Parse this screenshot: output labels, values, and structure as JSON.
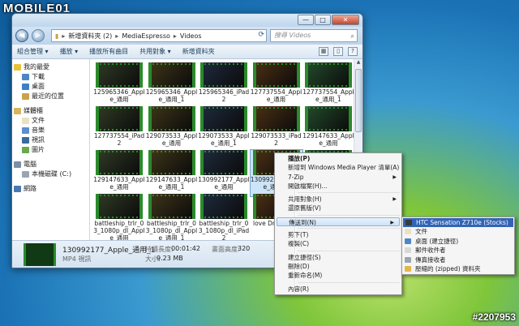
{
  "watermark": {
    "logo": "MOBILE01",
    "id": "#2207953"
  },
  "window": {
    "controls": {
      "min": "—",
      "max": "□",
      "close": "✕"
    },
    "address": {
      "segments": [
        "新增資料夾 (2)",
        "MediaEspresso",
        "Videos"
      ]
    },
    "search_placeholder": "搜尋 Videos",
    "toolbar": {
      "organize": "組合管理 ▾",
      "play": "播放 ▾",
      "play_all": "播放所有曲目",
      "share": "共用對象 ▾",
      "new_folder": "新增資料夾"
    }
  },
  "nav": {
    "favorites": "我的最愛",
    "favorites_items": [
      "下載",
      "桌面",
      "最近的位置"
    ],
    "libraries": "媒體櫃",
    "libraries_items": [
      "文件",
      "音樂",
      "視訊",
      "圖片"
    ],
    "computer": "電腦",
    "computer_items": [
      "本機磁碟 (C:)"
    ],
    "network": "網路"
  },
  "files": [
    {
      "name": "125965346_Apple_通用"
    },
    {
      "name": "125965346_Apple_通用_1"
    },
    {
      "name": "125965346_iPad2"
    },
    {
      "name": "127737554_Apple_通用"
    },
    {
      "name": "127737554_Apple_通用_1"
    },
    {
      "name": "127737554_iPad2"
    },
    {
      "name": "129073533_Apple_通用"
    },
    {
      "name": "129073533_Apple_通用_1"
    },
    {
      "name": "129073533_iPad2"
    },
    {
      "name": "129147633_Apple_通用"
    },
    {
      "name": "129147633_Apple_通用"
    },
    {
      "name": "129147633_Apple_通用_1"
    },
    {
      "name": "130992177_Apple_通用"
    },
    {
      "name": "130992177_Apple_通用_1"
    },
    {
      "name": ""
    },
    {
      "name": "battleship_trlr_03_1080p_dl_Apple_通用"
    },
    {
      "name": "battleship_trlr_03_1080p_dl_Apple_通用_1"
    },
    {
      "name": "battleship_trlr_03_1080p_dl_iPad2"
    },
    {
      "name": "love Dream1_A"
    },
    {
      "name": ""
    }
  ],
  "status": {
    "name": "130992177_Apple_通用_1",
    "type": "MP4 視訊",
    "duration_label": "持續長度:",
    "duration": "00:01:42",
    "size_label": "大小:",
    "size": "9.23 MB",
    "height_label": "畫面高度:",
    "height": "320"
  },
  "context_menu": {
    "items": [
      {
        "label": "播放(P)",
        "bold": true
      },
      {
        "label": "新增到 Windows Media Player 清單(A)"
      },
      {
        "label": "7-Zip",
        "submenu": true
      },
      {
        "label": "開啟檔案(H)..."
      },
      {
        "sep": true
      },
      {
        "label": "共用對象(H)",
        "submenu": true
      },
      {
        "label": "還原舊版(V)"
      },
      {
        "sep": true
      },
      {
        "label": "傳送到(N)",
        "submenu": true,
        "highlighted": true
      },
      {
        "sep": true
      },
      {
        "label": "剪下(T)"
      },
      {
        "label": "複製(C)"
      },
      {
        "sep": true
      },
      {
        "label": "建立捷徑(S)"
      },
      {
        "label": "刪除(D)"
      },
      {
        "label": "重新命名(M)"
      },
      {
        "sep": true
      },
      {
        "label": "內容(R)"
      }
    ]
  },
  "send_to_menu": {
    "items": [
      {
        "label": "HTC Sensation Z710e (Stocks)",
        "highlighted": true,
        "icon": "phone-icon",
        "color": "#3a3a3a"
      },
      {
        "label": "文件",
        "icon": "document-icon",
        "color": "#e8e1c4"
      },
      {
        "label": "桌面 (建立捷徑)",
        "icon": "desktop-icon",
        "color": "#4f86c6"
      },
      {
        "label": "郵件收件者",
        "icon": "mail-icon",
        "color": "#d8d8d8"
      },
      {
        "label": "傳真接收者",
        "icon": "fax-icon",
        "color": "#9aa5b1"
      },
      {
        "label": "壓縮的 (zipped) 資料夾",
        "icon": "zip-folder-icon",
        "color": "#e3b64c"
      }
    ]
  }
}
